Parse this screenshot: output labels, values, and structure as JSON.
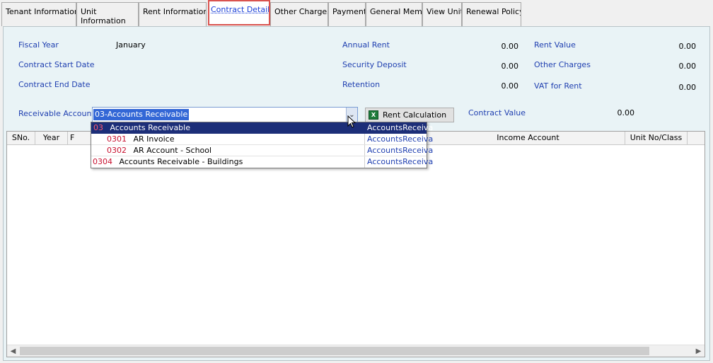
{
  "tabs": [
    {
      "label": "Tenant Information"
    },
    {
      "label": "Unit Information"
    },
    {
      "label": "Rent Information"
    },
    {
      "label": "Contract Details"
    },
    {
      "label": "Other Charges"
    },
    {
      "label": "Payments"
    },
    {
      "label": "General Memo"
    },
    {
      "label": "View Unit"
    },
    {
      "label": "Renewal Policy"
    }
  ],
  "form": {
    "fiscal_year_label": "Fiscal Year",
    "fiscal_year_value": "January",
    "contract_start_label": "Contract Start Date",
    "contract_end_label": "Contract End Date",
    "annual_rent_label": "Annual Rent",
    "annual_rent_value": "0.00",
    "security_deposit_label": "Security Deposit",
    "security_deposit_value": "0.00",
    "retention_label": "Retention",
    "retention_value": "0.00",
    "rent_value_label": "Rent Value",
    "rent_value_value": "0.00",
    "other_charges_label": "Other Charges",
    "other_charges_value": "0.00",
    "vat_label": "VAT for Rent",
    "vat_value": "0.00",
    "receivable_label": "Receivable Account",
    "receivable_value": "03-Accounts Receivable",
    "rent_calc_label": "Rent Calculation",
    "contract_value_label": "Contract Value",
    "contract_value_value": "0.00"
  },
  "grid": {
    "columns": [
      "SNo.",
      "Year",
      "F",
      "Income Account",
      "Unit No/Class"
    ]
  },
  "dropdown": {
    "items": [
      {
        "code": "03",
        "name": "Accounts Receivable",
        "type": "AccountsReceiva"
      },
      {
        "code": "0301",
        "name": "AR Invoice",
        "type": "AccountsReceiva"
      },
      {
        "code": "0302",
        "name": "AR Account - School",
        "type": "AccountsReceiva"
      },
      {
        "code": "0304",
        "name": "Accounts Receivable - Buildings",
        "type": "AccountsReceiva"
      }
    ]
  },
  "icons": {
    "combo_arrow": "chevron-down-icon",
    "excel": "excel-icon",
    "scroll_left": "arrow-left-icon",
    "scroll_right": "arrow-right-icon"
  },
  "colors": {
    "active_tab_border": "#d9534f",
    "label_blue": "#1f3fb0",
    "panel_bg": "#e9f3f6",
    "selection": "#1c2e78",
    "code_red": "#c8102e"
  }
}
